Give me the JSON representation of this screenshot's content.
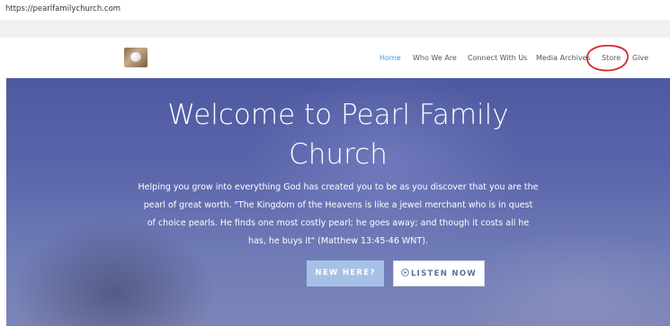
{
  "browser": {
    "url": "https://pearlfamilychurch.com"
  },
  "nav": {
    "items": [
      {
        "label": "Home",
        "active": true
      },
      {
        "label": "Who We Are",
        "active": false
      },
      {
        "label": "Connect With Us",
        "active": false
      },
      {
        "label": "Media Archives",
        "active": false
      },
      {
        "label": "Store",
        "active": false
      },
      {
        "label": "Give",
        "active": false
      }
    ],
    "search_icon": "search-icon",
    "annotation": "red-circle-around-store"
  },
  "hero": {
    "title_line1": "Welcome to Pearl Family",
    "title_line2": "Church",
    "text_lines": [
      "Helping you grow into everything God has created you to be as you discover that you are the",
      "pearl of great worth. \"The  Kingdom of the  Heavens is like a jewel merchant who is in quest",
      "of choice pearls.  He finds one most costly pearl; he goes away; and though it costs all he",
      "has, he buys it\" (Matthew 13:45-46 WNT)."
    ],
    "buttons": {
      "new_here": "NEW HERE?",
      "listen_now": "LISTEN NOW"
    }
  },
  "colors": {
    "accent": "#2ea3f2",
    "annotation": "#d62a2a",
    "hero_button": "#a7c0e6"
  }
}
